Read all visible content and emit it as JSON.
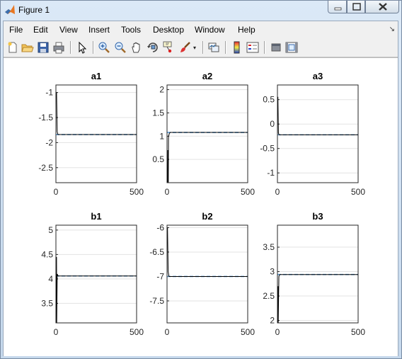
{
  "window": {
    "title": "Figure 1"
  },
  "menu": [
    "File",
    "Edit",
    "View",
    "Insert",
    "Tools",
    "Desktop",
    "Window",
    "Help"
  ],
  "toolbar": [
    "new-figure-icon",
    "open-file-icon",
    "save-icon",
    "print-icon",
    "edit-plot-arrow-icon",
    "zoom-in-icon",
    "zoom-out-icon",
    "pan-hand-icon",
    "rotate-3d-icon",
    "data-cursor-icon",
    "brush-icon",
    "link-plot-icon",
    "colorbar-icon",
    "legend-icon",
    "hide-plot-tools-icon",
    "show-plot-tools-icon"
  ],
  "colors": {
    "response": "#000000",
    "reference": "#5a9bd5",
    "grid": "#e3e3e3"
  },
  "chart_data": [
    {
      "type": "line",
      "title": "a1",
      "xlim": [
        0,
        500
      ],
      "ylim": [
        -2.8,
        -0.85
      ],
      "xticks": [
        0,
        500
      ],
      "yticks": [
        -2.5,
        -2,
        -1.5,
        -1
      ],
      "ytick_labels": [
        "-2.5",
        "-2",
        "-1.5",
        "-1"
      ],
      "series": [
        {
          "x": [
            0,
            4,
            8,
            12,
            20,
            500
          ],
          "y": [
            -1.0,
            -1.0,
            -1.78,
            -1.84,
            -1.84,
            -1.84
          ]
        },
        {
          "x": [
            0,
            500
          ],
          "y": [
            -1.84,
            -1.84
          ]
        }
      ]
    },
    {
      "type": "line",
      "title": "a2",
      "xlim": [
        0,
        500
      ],
      "ylim": [
        0.0,
        2.1
      ],
      "xticks": [
        0,
        500
      ],
      "yticks": [
        0.5,
        1,
        1.5,
        2
      ],
      "ytick_labels": [
        "0.5",
        "1",
        "1.5",
        "2"
      ],
      "series": [
        {
          "x": [
            0,
            4,
            5,
            8,
            9,
            14,
            20,
            500
          ],
          "y": [
            0.0,
            0.0,
            0.7,
            0.0,
            0.98,
            1.06,
            1.08,
            1.08
          ]
        },
        {
          "x": [
            0,
            500
          ],
          "y": [
            1.08,
            1.08
          ]
        }
      ]
    },
    {
      "type": "line",
      "title": "a3",
      "xlim": [
        0,
        500
      ],
      "ylim": [
        -1.2,
        0.8
      ],
      "xticks": [
        0,
        500
      ],
      "yticks": [
        -1,
        -0.5,
        0,
        0.5
      ],
      "ytick_labels": [
        "-1",
        "-0.5",
        "0",
        "0.5"
      ],
      "series": [
        {
          "x": [
            0,
            3,
            6,
            10,
            16,
            500
          ],
          "y": [
            0.55,
            0.55,
            -0.18,
            -0.22,
            -0.22,
            -0.22
          ]
        },
        {
          "x": [
            0,
            500
          ],
          "y": [
            -0.22,
            -0.22
          ]
        }
      ]
    },
    {
      "type": "line",
      "title": "b1",
      "xlim": [
        0,
        500
      ],
      "ylim": [
        3.1,
        5.1
      ],
      "xticks": [
        0,
        500
      ],
      "yticks": [
        3.5,
        4,
        4.5,
        5
      ],
      "ytick_labels": [
        "3.5",
        "4",
        "4.5",
        "5"
      ],
      "series": [
        {
          "x": [
            0,
            3,
            4,
            5,
            8,
            14,
            500
          ],
          "y": [
            3.1,
            3.1,
            4.45,
            3.1,
            4.1,
            4.06,
            4.06
          ]
        },
        {
          "x": [
            0,
            500
          ],
          "y": [
            4.06,
            4.06
          ]
        }
      ]
    },
    {
      "type": "line",
      "title": "b2",
      "xlim": [
        0,
        500
      ],
      "ylim": [
        -7.95,
        -5.95
      ],
      "xticks": [
        0,
        500
      ],
      "yticks": [
        -7.5,
        -7,
        -6.5,
        -6
      ],
      "ytick_labels": [
        "-7.5",
        "-7",
        "-6.5",
        "-6"
      ],
      "series": [
        {
          "x": [
            0,
            3,
            7,
            12,
            18,
            500
          ],
          "y": [
            -6.0,
            -6.0,
            -6.9,
            -7.0,
            -7.0,
            -7.0
          ]
        },
        {
          "x": [
            0,
            500
          ],
          "y": [
            -7.0,
            -7.0
          ]
        }
      ]
    },
    {
      "type": "line",
      "title": "b3",
      "xlim": [
        0,
        500
      ],
      "ylim": [
        1.95,
        3.95
      ],
      "xticks": [
        0,
        500
      ],
      "yticks": [
        2,
        2.5,
        3,
        3.5
      ],
      "ytick_labels": [
        "2",
        "2.5",
        "3",
        "3.5"
      ],
      "series": [
        {
          "x": [
            0,
            3,
            4,
            5,
            9,
            14,
            500
          ],
          "y": [
            1.95,
            1.95,
            2.7,
            1.95,
            2.9,
            2.94,
            2.94
          ]
        },
        {
          "x": [
            0,
            500
          ],
          "y": [
            2.94,
            2.94
          ]
        }
      ]
    }
  ]
}
